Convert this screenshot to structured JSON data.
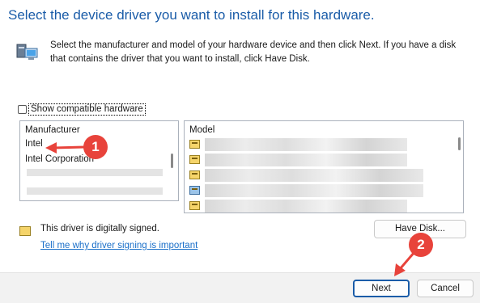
{
  "header": {
    "title": "Select the device driver you want to install for this hardware.",
    "description": "Select the manufacturer and model of your hardware device and then click Next. If you have a disk that contains the driver that you want to install, click Have Disk."
  },
  "compat_checkbox": {
    "label": "Show compatible hardware",
    "checked": false
  },
  "manufacturer_list": {
    "header": "Manufacturer",
    "items": [
      "Intel",
      "Intel Corporation"
    ]
  },
  "model_list": {
    "header": "Model"
  },
  "signing": {
    "status_text": "This driver is digitally signed.",
    "link_text": "Tell me why driver signing is important"
  },
  "buttons": {
    "have_disk": "Have Disk...",
    "next": "Next",
    "cancel": "Cancel"
  },
  "annotations": {
    "badge_1": "1",
    "badge_2": "2",
    "accent_color": "#e8433b"
  },
  "icons": {
    "hardware": "hardware-device-icon",
    "driver": "driver-package-icon",
    "certificate": "certificate-icon"
  }
}
